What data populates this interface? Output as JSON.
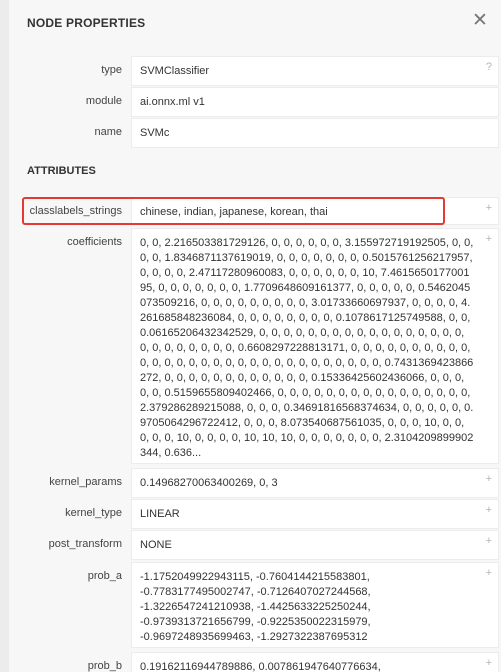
{
  "panel": {
    "title": "NODE PROPERTIES",
    "close_glyph": "✕"
  },
  "properties": [
    {
      "label": "type",
      "value": "SVMClassifier",
      "control": "?"
    },
    {
      "label": "module",
      "value": "ai.onnx.ml v1"
    },
    {
      "label": "name",
      "value": "SVMc"
    }
  ],
  "attributes_title": "ATTRIBUTES",
  "attributes": [
    {
      "label": "classlabels_strings",
      "value": "chinese, indian, japanese, korean, thai",
      "control": "+"
    },
    {
      "label": "coefficients",
      "value": "0, 0, 2.216503381729126, 0, 0, 0, 0, 0, 0, 3.155972719192505, 0, 0, 0, 0, 1.8346871137619019, 0, 0, 0, 0, 0, 0, 0, 0.5015761256217957, 0, 0, 0, 0, 2.47117280960083, 0, 0, 0, 0, 0, 0, 10, 7.461565017700195, 0, 0, 0, 0, 0, 0, 0, 1.7709648609161377, 0, 0, 0, 0, 0, 0.5462045073509216, 0, 0, 0, 0, 0, 0, 0, 0, 0, 3.01733660697937, 0, 0, 0, 0, 4.261685848236084, 0, 0, 0, 0, 0, 0, 0, 0, 0.1078617125749588, 0, 0, 0.06165206432342529, 0, 0, 0, 0, 0, 0, 0, 0, 0, 0, 0, 0, 0, 0, 0, 0, 0, 0, 0, 0, 0, 0, 0, 0, 0, 0.6608297228813171, 0, 0, 0, 0, 0, 0, 0, 0, 0, 0, 0, 0, 0, 0, 0, 0, 0, 0, 0, 0, 0, 0, 0, 0, 0, 0, 0, 0, 0, 0, 0.7431369423866272, 0, 0, 0, 0, 0, 0, 0, 0, 0, 0, 0, 0, 0.15336425602436066, 0, 0, 0, 0, 0, 0.5159655809402466, 0, 0, 0, 0, 0, 0, 0, 0, 0, 0, 0, 0, 0, 0, 0, 0, 2.379286289215088, 0, 0, 0, 0.34691816568374634, 0, 0, 0, 0, 0, 0.9705064296722412, 0, 0, 0, 8.073540687561035, 0, 0, 0, 10, 0, 0, 0, 0, 0, 10, 0, 0, 0, 0, 10, 10, 10, 0, 0, 0, 0, 0, 0, 0, 2.3104209899902344, 0.636...",
      "control": "+"
    },
    {
      "label": "kernel_params",
      "value": "0.14968270063400269, 0, 3",
      "control": "+"
    },
    {
      "label": "kernel_type",
      "value": "LINEAR",
      "control": "+"
    },
    {
      "label": "post_transform",
      "value": "NONE",
      "control": "+"
    },
    {
      "label": "prob_a",
      "value": "-1.1752049922943115, -0.7604144215583801,\n-0.7783177495002747, -0.7126407027244568,\n-1.3226547241210938, -1.4425633225250244,\n-0.9739313721656799, -0.9225350022315979,\n-0.9697248935699463, -1.2927322387695312",
      "control": "+"
    },
    {
      "label": "prob_b",
      "value": "0.19162116944789886, 0.007861947640776634,",
      "control": "+"
    }
  ],
  "colors": {
    "highlight": "#e53935",
    "panel_bg": "#f7f7f7",
    "field_bg": "#ffffff"
  }
}
